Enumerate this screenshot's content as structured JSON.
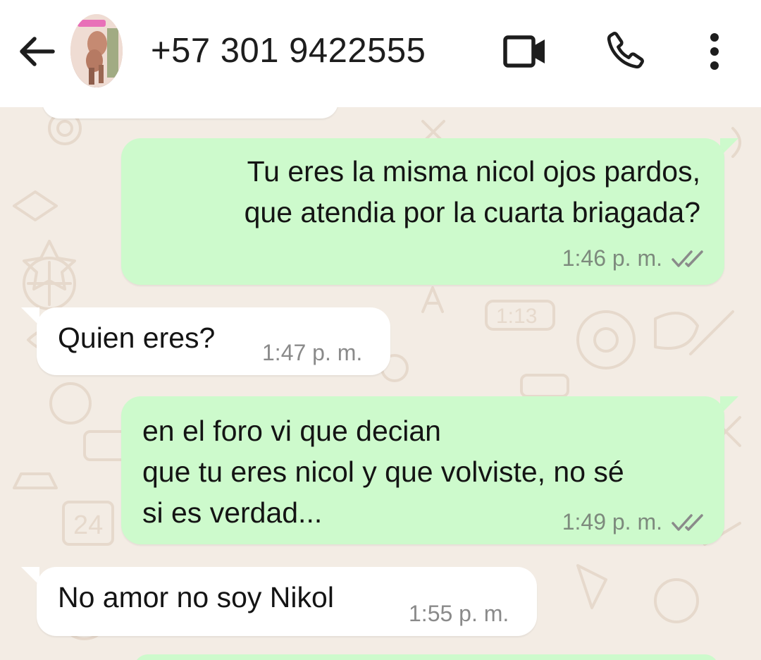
{
  "header": {
    "contact_name": "+57 301 9422555",
    "icons": {
      "back": "arrow-left-icon",
      "video": "video-camera-icon",
      "call": "phone-icon",
      "menu": "more-vertical-icon"
    }
  },
  "colors": {
    "header_bg": "#ffffff",
    "chat_bg": "#f3ece4",
    "outgoing_bubble": "#cdfacc",
    "incoming_bubble": "#ffffff",
    "read_ticks": "#8a8a8a"
  },
  "messages": [
    {
      "direction": "outgoing",
      "text": "Tu eres la misma nicol ojos pardos,\nque atendia por la cuarta briagada?",
      "time": "1:46 p. m.",
      "status": "read"
    },
    {
      "direction": "incoming",
      "text": "Quien eres?",
      "time": "1:47 p. m."
    },
    {
      "direction": "outgoing",
      "text": "en el foro vi que decian\nque tu eres nicol y que volviste, no sé\nsi es verdad...",
      "time": "1:49 p. m.",
      "status": "read"
    },
    {
      "direction": "incoming",
      "text": "No amor no soy Nikol",
      "time": "1:55 p. m."
    }
  ]
}
